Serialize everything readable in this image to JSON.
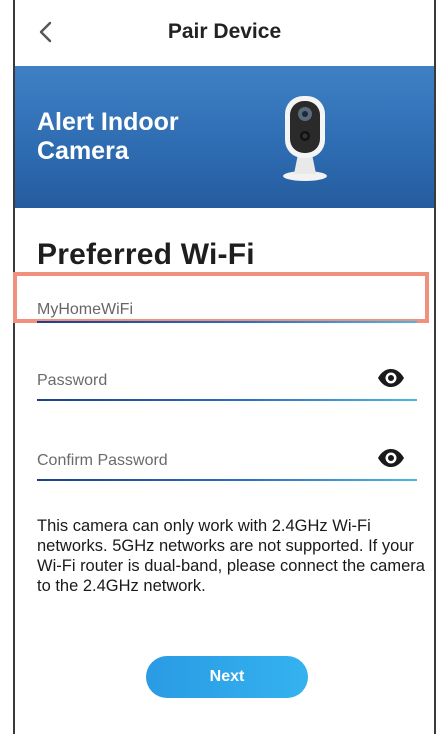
{
  "header": {
    "title": "Pair Device",
    "back_icon": "chevron-left-icon"
  },
  "banner": {
    "title": "Alert Indoor Camera",
    "image": "indoor-camera-image"
  },
  "form": {
    "section_title": "Preferred Wi-Fi",
    "wifi": {
      "value": "MyHomeWiFi",
      "placeholder": ""
    },
    "password": {
      "placeholder": "Password",
      "icon": "eye-icon"
    },
    "confirm_password": {
      "placeholder": "Confirm Password",
      "icon": "eye-icon"
    }
  },
  "info": {
    "text": "This camera can only work with 2.4GHz Wi-Fi networks. 5GHz networks are not supported. If your Wi-Fi router is dual-band, please connect the camera to the 2.4GHz network."
  },
  "actions": {
    "next_label": "Next"
  },
  "colors": {
    "banner": "#2f6db3",
    "accent": "#2a9be4",
    "highlight": "#f0917e"
  }
}
